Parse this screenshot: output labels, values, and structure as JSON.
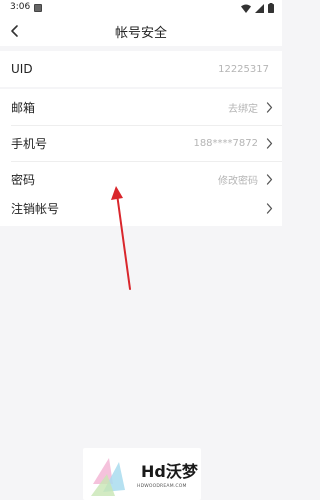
{
  "status_bar": {
    "time": "3:06"
  },
  "nav": {
    "title": "帐号安全"
  },
  "rows": [
    {
      "label": "UID",
      "value": "12225317"
    },
    {
      "label": "邮箱",
      "value": "去绑定"
    },
    {
      "label": "手机号",
      "value": "188****7872"
    },
    {
      "label": "密码",
      "value": "修改密码"
    },
    {
      "label": "注销帐号",
      "value": ""
    }
  ],
  "watermark": {
    "brand": "Hd沃梦",
    "url": "HDWOODREAM.COM"
  },
  "colors": {
    "annotation_arrow": "#d9262c",
    "secondary_text": "#b5b5b5"
  }
}
